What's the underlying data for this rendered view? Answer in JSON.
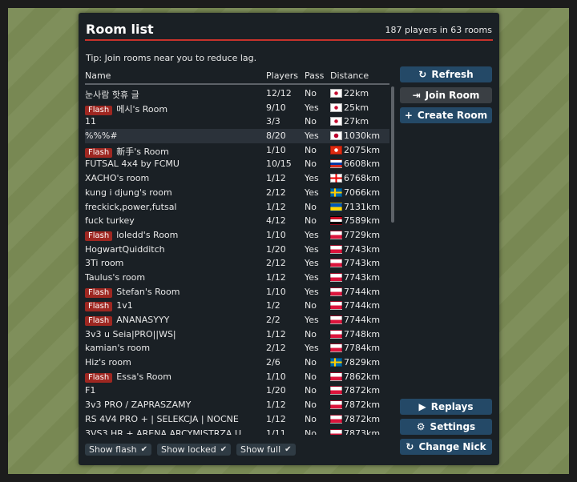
{
  "dialog": {
    "title": "Room list",
    "summary": "187 players in 63 rooms",
    "tip": "Tip: Join rooms near you to reduce lag."
  },
  "columns": {
    "name": "Name",
    "players": "Players",
    "pass": "Pass",
    "distance": "Distance"
  },
  "flash_label": "Flash",
  "rooms": [
    {
      "name": "눈사람 핫휴 글",
      "flash": false,
      "players": "12/12",
      "pass": "No",
      "flag": "kr",
      "distance": "22km"
    },
    {
      "name": "메시's Room",
      "flash": true,
      "players": "9/10",
      "pass": "Yes",
      "flag": "kr",
      "distance": "25km"
    },
    {
      "name": "11",
      "flash": false,
      "players": "3/3",
      "pass": "No",
      "flag": "kr",
      "distance": "27km"
    },
    {
      "name": "%%%#",
      "flash": false,
      "players": "8/20",
      "pass": "Yes",
      "flag": "jp",
      "distance": "1030km",
      "selected": true
    },
    {
      "name": "新手's Room",
      "flash": true,
      "players": "1/10",
      "pass": "No",
      "flag": "hk",
      "distance": "2075km"
    },
    {
      "name": "FUTSAL 4x4 by FCMU",
      "flash": false,
      "players": "10/15",
      "pass": "No",
      "flag": "ru",
      "distance": "6608km"
    },
    {
      "name": "XACHO's room",
      "flash": false,
      "players": "1/12",
      "pass": "Yes",
      "flag": "ge",
      "distance": "6768km"
    },
    {
      "name": "kung i djung's room",
      "flash": false,
      "players": "2/12",
      "pass": "Yes",
      "flag": "se",
      "distance": "7066km"
    },
    {
      "name": "freckick,power,futsal",
      "flash": false,
      "players": "1/12",
      "pass": "No",
      "flag": "ua",
      "distance": "7131km"
    },
    {
      "name": "fuck turkey",
      "flash": false,
      "players": "4/12",
      "pass": "No",
      "flag": "iq",
      "distance": "7589km"
    },
    {
      "name": "loledd's Room",
      "flash": true,
      "players": "1/10",
      "pass": "Yes",
      "flag": "pl",
      "distance": "7729km"
    },
    {
      "name": "HogwartQuidditch",
      "flash": false,
      "players": "1/20",
      "pass": "Yes",
      "flag": "pl",
      "distance": "7743km"
    },
    {
      "name": "3Ti room",
      "flash": false,
      "players": "2/12",
      "pass": "Yes",
      "flag": "pl",
      "distance": "7743km"
    },
    {
      "name": "Taulus's room",
      "flash": false,
      "players": "1/12",
      "pass": "Yes",
      "flag": "pl",
      "distance": "7743km"
    },
    {
      "name": "Stefan's Room",
      "flash": true,
      "players": "1/10",
      "pass": "Yes",
      "flag": "pl",
      "distance": "7744km"
    },
    {
      "name": "1v1",
      "flash": true,
      "players": "1/2",
      "pass": "No",
      "flag": "pl",
      "distance": "7744km"
    },
    {
      "name": "ANANASYYY",
      "flash": true,
      "players": "2/2",
      "pass": "Yes",
      "flag": "pl",
      "distance": "7744km"
    },
    {
      "name": "3v3 u Seia|PRO||WS|",
      "flash": false,
      "players": "1/12",
      "pass": "No",
      "flag": "pl",
      "distance": "7748km"
    },
    {
      "name": "kamian's room",
      "flash": false,
      "players": "2/12",
      "pass": "Yes",
      "flag": "pl",
      "distance": "7784km"
    },
    {
      "name": "Hiz's room",
      "flash": false,
      "players": "2/6",
      "pass": "No",
      "flag": "se",
      "distance": "7829km"
    },
    {
      "name": "Essa's Room",
      "flash": true,
      "players": "1/10",
      "pass": "No",
      "flag": "pl",
      "distance": "7862km"
    },
    {
      "name": "F1",
      "flash": false,
      "players": "1/20",
      "pass": "No",
      "flag": "pl",
      "distance": "7872km"
    },
    {
      "name": "3v3 PRO / ZAPRASZAMY",
      "flash": false,
      "players": "1/12",
      "pass": "No",
      "flag": "pl",
      "distance": "7872km"
    },
    {
      "name": "RS 4V4 PRO + | SELEKCJA | NOCNE",
      "flash": false,
      "players": "1/12",
      "pass": "No",
      "flag": "pl",
      "distance": "7872km"
    },
    {
      "name": "3VS3 HR + ARENA ARCYMISTRZA U",
      "flash": false,
      "players": "1/11",
      "pass": "No",
      "flag": "pl",
      "distance": "7873km"
    }
  ],
  "buttons": {
    "refresh": "Refresh",
    "join": "Join Room",
    "create": "Create Room",
    "replays": "Replays",
    "settings": "Settings",
    "change_nick": "Change Nick"
  },
  "filters": {
    "show_flash": "Show flash",
    "show_locked": "Show locked",
    "show_full": "Show full"
  },
  "colors": {
    "accent_red": "#c8322b",
    "button_blue": "#244967",
    "flash_badge": "#9e2721"
  }
}
